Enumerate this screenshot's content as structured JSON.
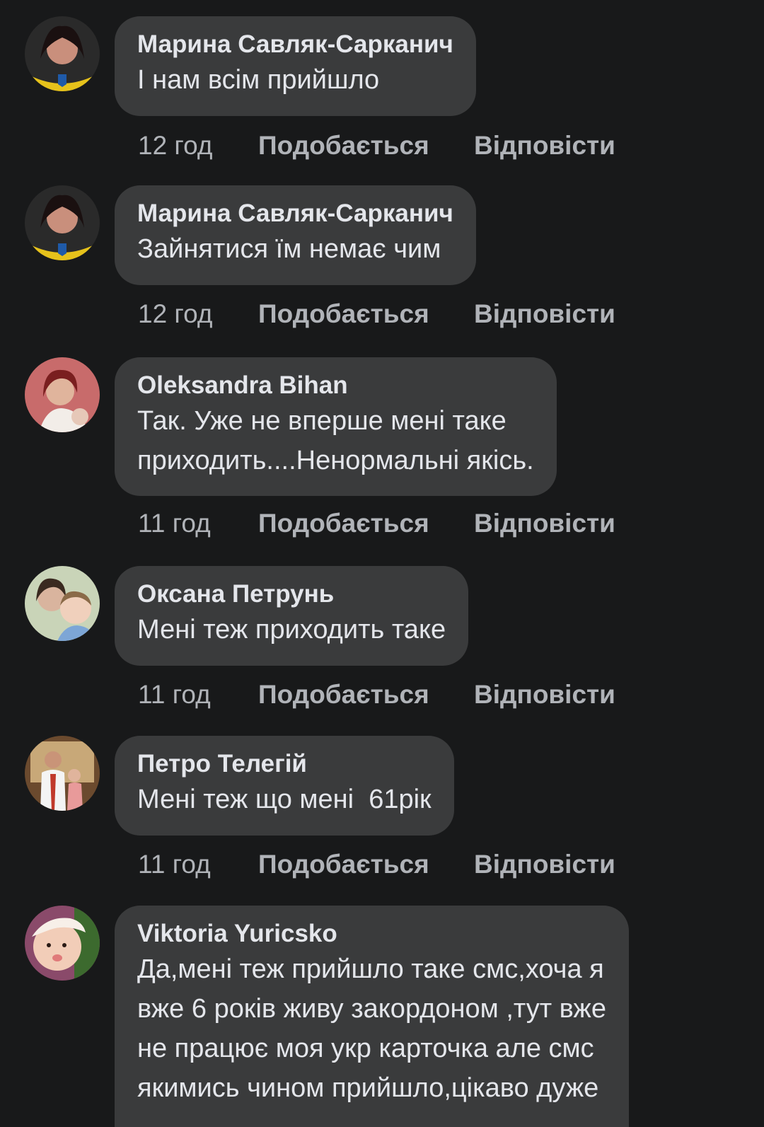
{
  "actions": {
    "like_label": "Подобається",
    "reply_label": "Відповісти"
  },
  "comments": [
    {
      "author": "Марина Савляк-Сарканич",
      "text": "І нам всім прийшло",
      "time": "12 год",
      "avatar_icon": "user-avatar-icon"
    },
    {
      "author": "Марина Савляк-Сарканич",
      "text": "Зайнятися їм немає чим",
      "time": "12 год",
      "avatar_icon": "user-avatar-icon"
    },
    {
      "author": "Oleksandra Bihan",
      "text": "Так. Уже не вперше мені таке\nприходить....Ненормальні якісь.",
      "time": "11 год",
      "avatar_icon": "user-avatar-icon"
    },
    {
      "author": "Оксана Петрунь",
      "text": "Мені теж приходить таке",
      "time": "11 год",
      "avatar_icon": "user-avatar-icon"
    },
    {
      "author": "Петро Телегій",
      "text": "Мені теж що мені  61рік",
      "time": "11 год",
      "avatar_icon": "user-avatar-icon"
    },
    {
      "author": "Viktoria Yuricsko",
      "text": "Да,мені теж прийшло таке смс,хоча я\nвже 6 років живу закордоном ,тут вже\nне працює моя укр карточка але смс\nякимись чином прийшло,цікаво дуже",
      "time": "",
      "avatar_icon": "user-avatar-icon"
    }
  ],
  "colors": {
    "background": "#18191a",
    "bubble": "#3a3b3c",
    "text": "#e4e6eb",
    "secondary": "#b0b3b8"
  }
}
